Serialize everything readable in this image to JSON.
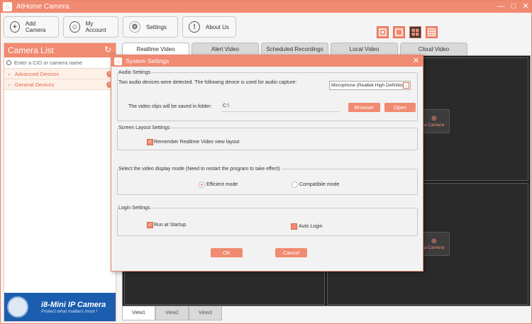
{
  "app": {
    "title": "AtHome Camera",
    "min": "—",
    "max": "□",
    "close": "✕"
  },
  "toolbar": {
    "add_camera": "Add Camera",
    "my_account": "My Account",
    "settings": "Settings",
    "about_us": "About Us"
  },
  "camera_list": {
    "title": "Camera List",
    "search_placeholder": "Enter a CID or camera name",
    "groups": [
      {
        "label": "Advanced Devices"
      },
      {
        "label": "General Devices"
      }
    ]
  },
  "banner": {
    "title": "i8-Mini IP Camera",
    "subtitle": "Protect what matters most !"
  },
  "tabs": [
    "Realtime Video",
    "Alert Video",
    "Scheduled Recordings",
    "Local Video",
    "Cloud Video"
  ],
  "video": {
    "add_label_1": "a Camera",
    "add_label_2": "a Camera"
  },
  "view_tabs": [
    "View1",
    "View2",
    "View3"
  ],
  "dialog": {
    "title": "System Settings",
    "audio": {
      "legend": "Audio Settings",
      "message": "Two audio devices were detected.  The following device is used for audio capture:",
      "device": "Microphone (Realtek High Definition",
      "folder_label": "The video clips will be saved in folder:",
      "folder": "C:\\",
      "browse": "Browser",
      "open": "Open"
    },
    "screen": {
      "legend": "Screen Layout Settings",
      "remember": "Remember Realtime Video view layout"
    },
    "display": {
      "legend": "Select the video display mode (Need to restart the program to take effect)",
      "efficient": "Efficient mode",
      "compatible": "Compatibile mode"
    },
    "login": {
      "legend": "Login Settings",
      "startup": "Run at Startup",
      "auto_login": "Auto Login"
    },
    "ok": "OK",
    "cancel": "Cancel"
  }
}
